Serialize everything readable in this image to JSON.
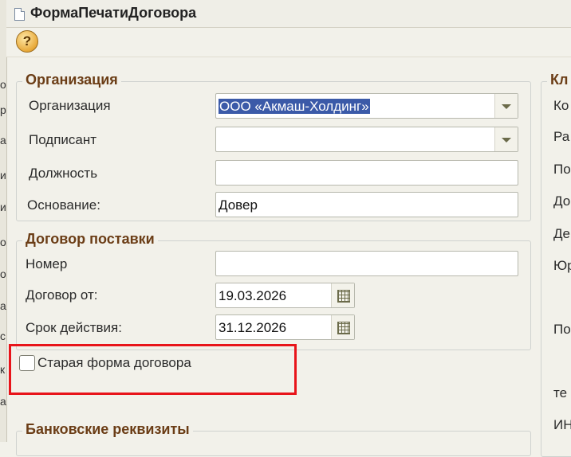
{
  "window": {
    "title": "ФормаПечатиДоговора"
  },
  "left_strip": [
    "о",
    "р",
    "а",
    "и",
    "и",
    "о",
    "о",
    "а",
    "с",
    "к",
    "а"
  ],
  "organization_group": {
    "title": "Организация",
    "org_label": "Организация",
    "org_value": "ООО «Акмаш-Холдинг»",
    "signer_label": "Подписант",
    "position_label": "Должность",
    "basis_label": "Основание:",
    "basis_value": "Довер"
  },
  "contract_group": {
    "title": "Договор поставки",
    "number_label": "Номер",
    "date_label": "Договор от:",
    "date_value": "19.03.2026",
    "validity_label": "Срок действия:",
    "validity_value": "31.12.2026"
  },
  "old_form": {
    "label": "Старая форма договора"
  },
  "bank_group": {
    "title": "Банковские реквизиты"
  },
  "client_group": {
    "title": "Кл",
    "labels": [
      "Ко",
      "Ра",
      "По",
      "До",
      "Де",
      "Юр",
      "По",
      "те",
      "ИН"
    ]
  }
}
